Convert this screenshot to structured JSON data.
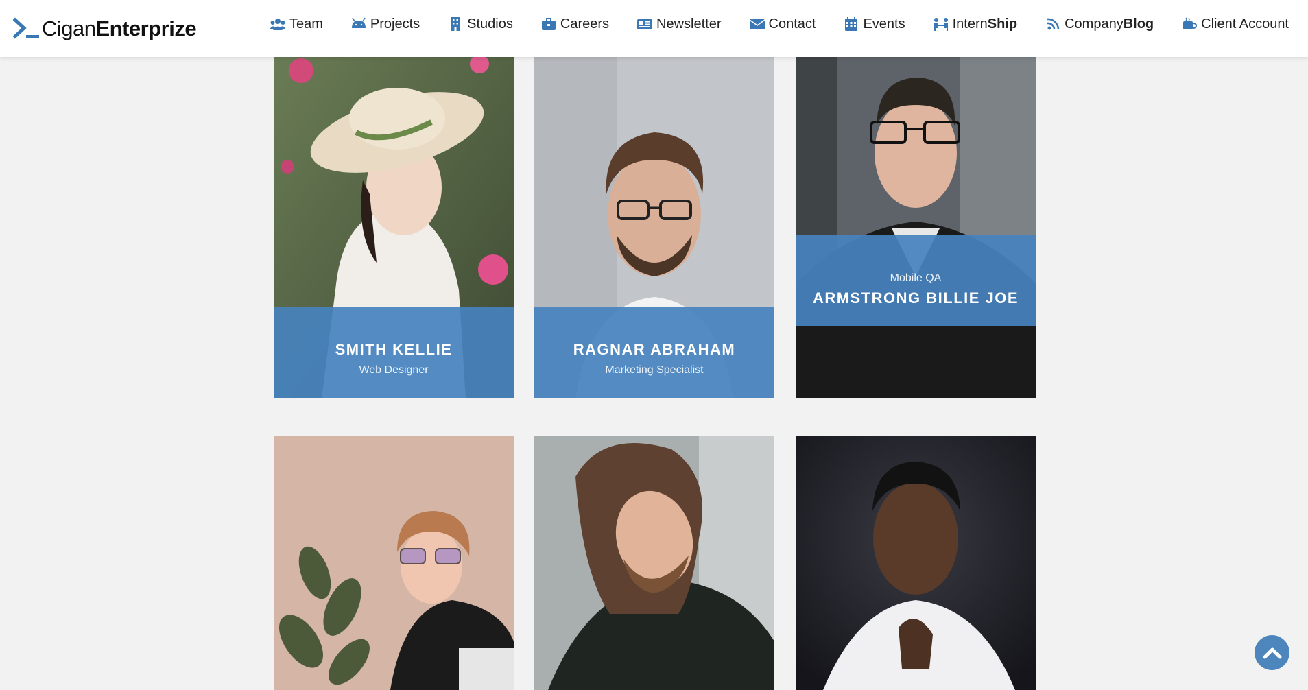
{
  "brand": {
    "prefix": "Cigan",
    "suffix": "Enterprize"
  },
  "nav": [
    {
      "label": "Team",
      "icon": "users-icon"
    },
    {
      "label": "Projects",
      "icon": "android-icon"
    },
    {
      "label": "Studios",
      "icon": "building-icon"
    },
    {
      "label": "Careers",
      "icon": "briefcase-icon"
    },
    {
      "label": "Newsletter",
      "icon": "newspaper-icon"
    },
    {
      "label": "Contact",
      "icon": "envelope-icon"
    },
    {
      "label": "Events",
      "icon": "calendar-icon"
    },
    {
      "label_pre": "Intern",
      "label_bold": "Ship",
      "icon": "group-icon"
    },
    {
      "label_pre": "Company",
      "label_bold": "Blog",
      "icon": "rss-icon"
    },
    {
      "label": "Client Account",
      "icon": "coffee-icon"
    }
  ],
  "team": [
    {
      "name": "Smith Kellie",
      "role": "Web Designer"
    },
    {
      "name": "Ragnar Abraham",
      "role": "Marketing Specialist"
    },
    {
      "name": "Armstrong Billie Joe",
      "role": "Mobile QA"
    },
    {
      "name": "",
      "role": ""
    },
    {
      "name": "",
      "role": ""
    },
    {
      "name": "",
      "role": ""
    }
  ],
  "colors": {
    "accent": "#4682be",
    "nav_icon": "#3a78b5",
    "page_bg": "#f2f2f2",
    "header_bg": "#ffffff"
  },
  "icons": {
    "scroll_top": "chevron-up-icon",
    "brand": "terminal-prompt-icon"
  }
}
